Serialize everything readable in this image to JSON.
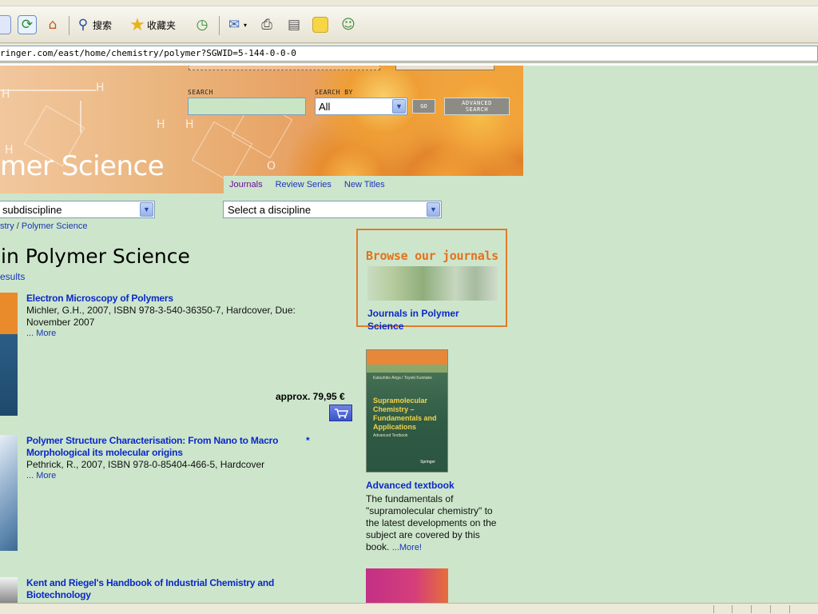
{
  "browser": {
    "toolbar": {
      "search_label": "搜索",
      "favorites_label": "收藏夹"
    },
    "address": "ringer.com/east/home/chemistry/polymer?SGWID=5-144-0-0-0"
  },
  "banner": {
    "title": "mer Science",
    "search_label": "SEARCH",
    "search_by_label": "SEARCH BY",
    "search_by_value": "All",
    "go_label": "GO",
    "advanced_line1": "ADVANCED",
    "advanced_line2": "SEARCH"
  },
  "tabs": [
    "Journals",
    "Review Series",
    "New Titles"
  ],
  "selects": {
    "subdiscipline": "subdiscipline",
    "discipline": "Select a discipline"
  },
  "breadcrumb": {
    "parent": "stry",
    "separator": " / ",
    "current": "Polymer Science"
  },
  "results": {
    "title": "in Polymer Science",
    "link": "esults"
  },
  "books": [
    {
      "title": "Electron Microscopy of Polymers",
      "meta": "Michler, G.H., 2007, ISBN 978-3-540-36350-7, Hardcover, Due: November 2007",
      "more": "... More",
      "price": "approx. 79,95 €"
    },
    {
      "title": "Polymer Structure Characterisation: From Nano to Macro Morphological its molecular origins",
      "meta": "Pethrick, R., 2007, ISBN 978-0-85404-466-5, Hardcover",
      "more": "... More",
      "marker": "*"
    },
    {
      "title": "Kent and Riegel's Handbook of Industrial Chemistry and Biotechnology"
    }
  ],
  "sidebar": {
    "journals_banner": "Browse our journals",
    "journals_link": "Journals in Polymer Science",
    "textbook_cover_title": "Supramolecular Chemistry – Fundamentals and Applications",
    "textbook_cover_subtitle": "Advanced Textbook",
    "textbook_cover_authors": "Katsuhiko Ariga / Toyoki Kunitake",
    "textbook_cover_publisher": "Springer",
    "textbook_heading": "Advanced textbook",
    "textbook_desc": "The fundamentals of \"supramolecular chemistry\" to the latest developments on the subject are covered by this book.",
    "textbook_more": "...More!"
  },
  "icons": [
    "refresh-icon",
    "home-icon",
    "search-icon",
    "favorites-star-icon",
    "history-icon",
    "mail-icon",
    "print-icon",
    "edit-icon",
    "note-icon",
    "messenger-icon",
    "cart-icon"
  ],
  "colors": {
    "page_bg": "#cde6cb",
    "link_blue": "#0a28c8",
    "orange_accent": "#e07c2a"
  }
}
